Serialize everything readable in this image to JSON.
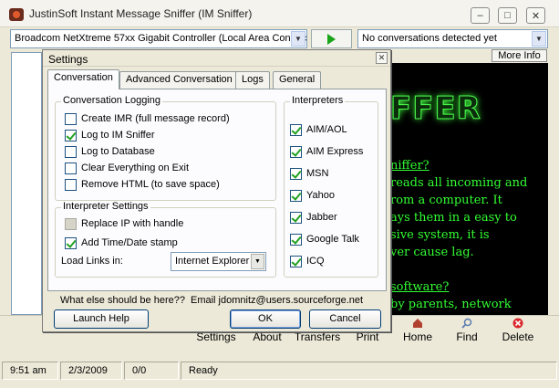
{
  "window": {
    "title": "JustinSoft Instant Message Sniffer (IM Sniffer)",
    "minimize": "–",
    "maximize": "□",
    "close": "✕"
  },
  "top_toolbar": {
    "adapter_value": "Broadcom NetXtreme 57xx Gigabit Controller (Local Area Connec",
    "conversations_value": "No conversations detected yet",
    "more_info_label": "More Info"
  },
  "background_panel": {
    "logo": "FFER",
    "lines": [
      {
        "text": "niffer?",
        "heading": true
      },
      {
        "text": "reads all incoming and",
        "heading": false
      },
      {
        "text": "rom a computer.  It",
        "heading": false
      },
      {
        "text": "ays them in a easy to",
        "heading": false
      },
      {
        "text": "sive system, it is",
        "heading": false
      },
      {
        "text": "ver cause lag.",
        "heading": false
      },
      {
        "text": "software?",
        "heading": true
      },
      {
        "text": "by parents, network",
        "heading": false
      }
    ]
  },
  "bottom_toolbar": {
    "items": [
      {
        "label": "Settings",
        "icon": "gear-icon"
      },
      {
        "label": "About",
        "icon": "info-icon"
      },
      {
        "label": "Transfers",
        "icon": "transfer-icon"
      },
      {
        "label": "Print",
        "icon": "print-icon"
      },
      {
        "label": "Home",
        "icon": "home-icon"
      },
      {
        "label": "Find",
        "icon": "search-icon"
      },
      {
        "label": "Delete",
        "icon": "delete-icon"
      }
    ]
  },
  "status_bar": {
    "time": "9:51 am",
    "date": "2/3/2009",
    "count": "0/0",
    "status": "Ready"
  },
  "dialog": {
    "title": "Settings",
    "close": "✕",
    "tabs": [
      {
        "label": "Conversation",
        "active": true
      },
      {
        "label": "Advanced Conversation",
        "active": false
      },
      {
        "label": "Logs",
        "active": false
      },
      {
        "label": "General",
        "active": false
      }
    ],
    "conversation_logging": {
      "title": "Conversation Logging",
      "options": [
        {
          "label": "Create IMR (full message record)",
          "checked": false
        },
        {
          "label": "Log to IM Sniffer",
          "checked": true
        },
        {
          "label": "Log to Database",
          "checked": false
        },
        {
          "label": "Clear Everything on Exit",
          "checked": false
        },
        {
          "label": "Remove HTML (to save space)",
          "checked": false
        }
      ]
    },
    "interpreter_settings": {
      "title": "Interpreter Settings",
      "replace_ip": {
        "label": "Replace IP with handle",
        "checked": false,
        "disabled": true
      },
      "add_time": {
        "label": "Add Time/Date stamp",
        "checked": true
      },
      "load_links_label": "Load Links in:",
      "load_links_value": "Internet Explorer"
    },
    "interpreters": {
      "title": "Interpreters",
      "options": [
        {
          "label": "AIM/AOL",
          "checked": true
        },
        {
          "label": "AIM Express",
          "checked": true
        },
        {
          "label": "MSN",
          "checked": true
        },
        {
          "label": "Yahoo",
          "checked": true
        },
        {
          "label": "Jabber",
          "checked": true
        },
        {
          "label": "Google Talk",
          "checked": true
        },
        {
          "label": "ICQ",
          "checked": true
        }
      ]
    },
    "footer_question": "What else should be here??",
    "footer_email": "Email jdomnitz@users.sourceforge.net",
    "buttons": {
      "launch_help": "Launch Help",
      "ok": "OK",
      "cancel": "Cancel"
    }
  },
  "colors": {
    "window_bg": "#ece9d8",
    "panel_black": "#000000",
    "neon_green": "#33ff33",
    "check_green": "#21a121",
    "delete_red": "#d9262b"
  }
}
